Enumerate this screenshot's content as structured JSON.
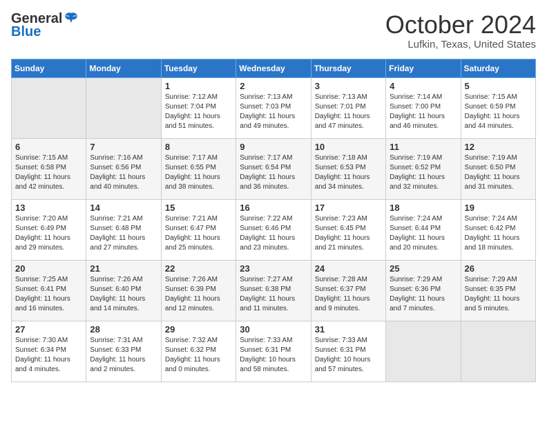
{
  "header": {
    "logo_general": "General",
    "logo_blue": "Blue",
    "title": "October 2024",
    "subtitle": "Lufkin, Texas, United States"
  },
  "columns": [
    "Sunday",
    "Monday",
    "Tuesday",
    "Wednesday",
    "Thursday",
    "Friday",
    "Saturday"
  ],
  "weeks": [
    [
      {
        "day": "",
        "info": ""
      },
      {
        "day": "",
        "info": ""
      },
      {
        "day": "1",
        "info": "Sunrise: 7:12 AM\nSunset: 7:04 PM\nDaylight: 11 hours and 51 minutes."
      },
      {
        "day": "2",
        "info": "Sunrise: 7:13 AM\nSunset: 7:03 PM\nDaylight: 11 hours and 49 minutes."
      },
      {
        "day": "3",
        "info": "Sunrise: 7:13 AM\nSunset: 7:01 PM\nDaylight: 11 hours and 47 minutes."
      },
      {
        "day": "4",
        "info": "Sunrise: 7:14 AM\nSunset: 7:00 PM\nDaylight: 11 hours and 46 minutes."
      },
      {
        "day": "5",
        "info": "Sunrise: 7:15 AM\nSunset: 6:59 PM\nDaylight: 11 hours and 44 minutes."
      }
    ],
    [
      {
        "day": "6",
        "info": "Sunrise: 7:15 AM\nSunset: 6:58 PM\nDaylight: 11 hours and 42 minutes."
      },
      {
        "day": "7",
        "info": "Sunrise: 7:16 AM\nSunset: 6:56 PM\nDaylight: 11 hours and 40 minutes."
      },
      {
        "day": "8",
        "info": "Sunrise: 7:17 AM\nSunset: 6:55 PM\nDaylight: 11 hours and 38 minutes."
      },
      {
        "day": "9",
        "info": "Sunrise: 7:17 AM\nSunset: 6:54 PM\nDaylight: 11 hours and 36 minutes."
      },
      {
        "day": "10",
        "info": "Sunrise: 7:18 AM\nSunset: 6:53 PM\nDaylight: 11 hours and 34 minutes."
      },
      {
        "day": "11",
        "info": "Sunrise: 7:19 AM\nSunset: 6:52 PM\nDaylight: 11 hours and 32 minutes."
      },
      {
        "day": "12",
        "info": "Sunrise: 7:19 AM\nSunset: 6:50 PM\nDaylight: 11 hours and 31 minutes."
      }
    ],
    [
      {
        "day": "13",
        "info": "Sunrise: 7:20 AM\nSunset: 6:49 PM\nDaylight: 11 hours and 29 minutes."
      },
      {
        "day": "14",
        "info": "Sunrise: 7:21 AM\nSunset: 6:48 PM\nDaylight: 11 hours and 27 minutes."
      },
      {
        "day": "15",
        "info": "Sunrise: 7:21 AM\nSunset: 6:47 PM\nDaylight: 11 hours and 25 minutes."
      },
      {
        "day": "16",
        "info": "Sunrise: 7:22 AM\nSunset: 6:46 PM\nDaylight: 11 hours and 23 minutes."
      },
      {
        "day": "17",
        "info": "Sunrise: 7:23 AM\nSunset: 6:45 PM\nDaylight: 11 hours and 21 minutes."
      },
      {
        "day": "18",
        "info": "Sunrise: 7:24 AM\nSunset: 6:44 PM\nDaylight: 11 hours and 20 minutes."
      },
      {
        "day": "19",
        "info": "Sunrise: 7:24 AM\nSunset: 6:42 PM\nDaylight: 11 hours and 18 minutes."
      }
    ],
    [
      {
        "day": "20",
        "info": "Sunrise: 7:25 AM\nSunset: 6:41 PM\nDaylight: 11 hours and 16 minutes."
      },
      {
        "day": "21",
        "info": "Sunrise: 7:26 AM\nSunset: 6:40 PM\nDaylight: 11 hours and 14 minutes."
      },
      {
        "day": "22",
        "info": "Sunrise: 7:26 AM\nSunset: 6:39 PM\nDaylight: 11 hours and 12 minutes."
      },
      {
        "day": "23",
        "info": "Sunrise: 7:27 AM\nSunset: 6:38 PM\nDaylight: 11 hours and 11 minutes."
      },
      {
        "day": "24",
        "info": "Sunrise: 7:28 AM\nSunset: 6:37 PM\nDaylight: 11 hours and 9 minutes."
      },
      {
        "day": "25",
        "info": "Sunrise: 7:29 AM\nSunset: 6:36 PM\nDaylight: 11 hours and 7 minutes."
      },
      {
        "day": "26",
        "info": "Sunrise: 7:29 AM\nSunset: 6:35 PM\nDaylight: 11 hours and 5 minutes."
      }
    ],
    [
      {
        "day": "27",
        "info": "Sunrise: 7:30 AM\nSunset: 6:34 PM\nDaylight: 11 hours and 4 minutes."
      },
      {
        "day": "28",
        "info": "Sunrise: 7:31 AM\nSunset: 6:33 PM\nDaylight: 11 hours and 2 minutes."
      },
      {
        "day": "29",
        "info": "Sunrise: 7:32 AM\nSunset: 6:32 PM\nDaylight: 11 hours and 0 minutes."
      },
      {
        "day": "30",
        "info": "Sunrise: 7:33 AM\nSunset: 6:31 PM\nDaylight: 10 hours and 58 minutes."
      },
      {
        "day": "31",
        "info": "Sunrise: 7:33 AM\nSunset: 6:31 PM\nDaylight: 10 hours and 57 minutes."
      },
      {
        "day": "",
        "info": ""
      },
      {
        "day": "",
        "info": ""
      }
    ]
  ]
}
